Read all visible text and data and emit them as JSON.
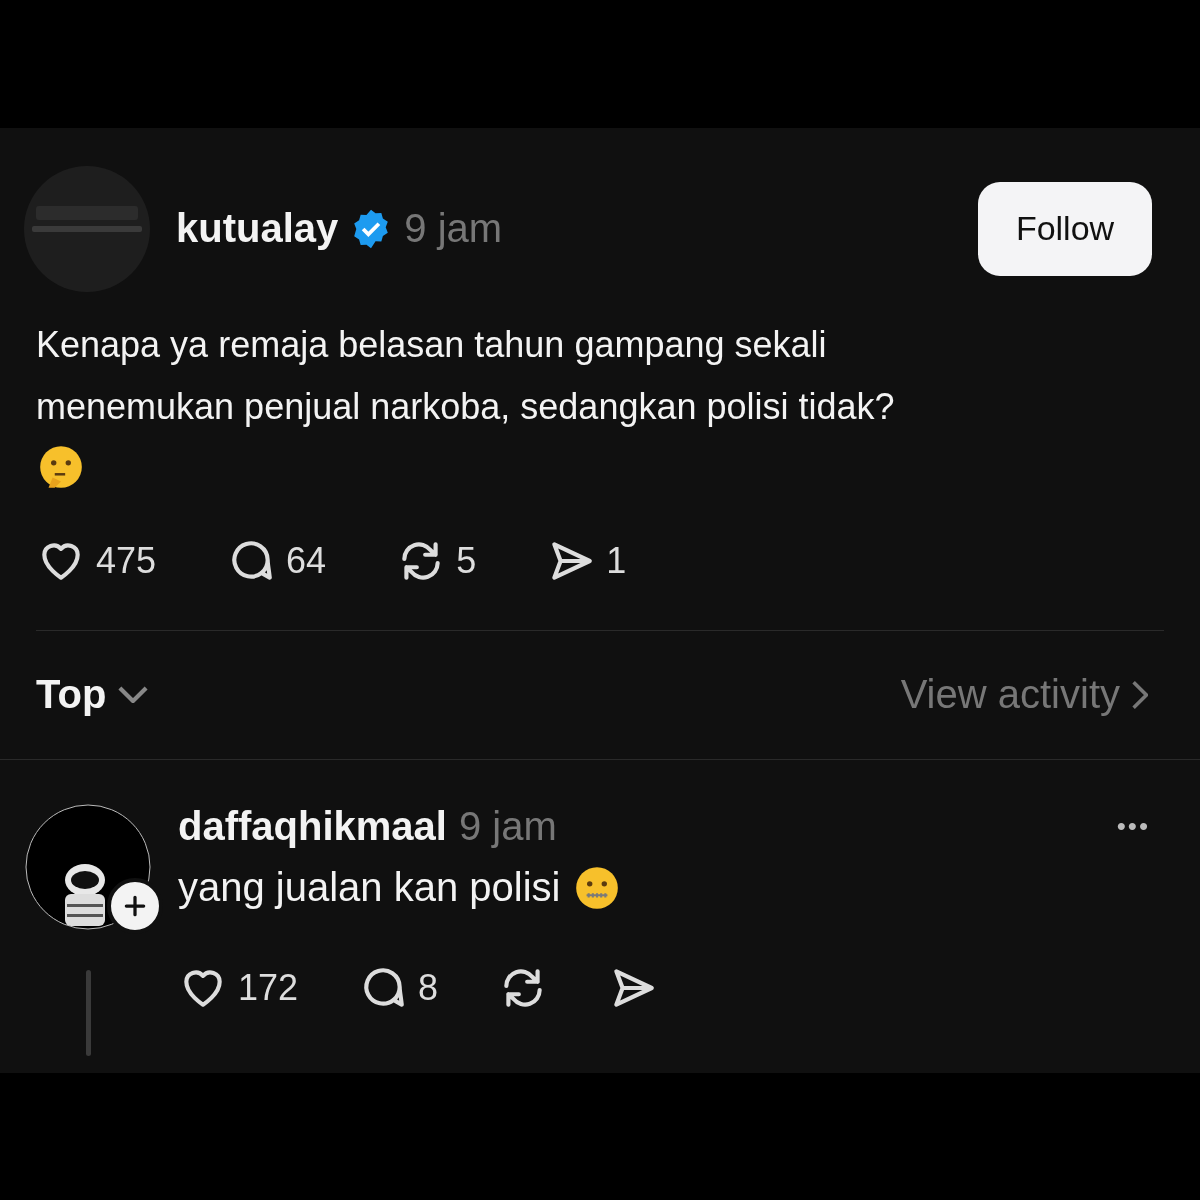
{
  "post": {
    "username": "kutualay",
    "verified": true,
    "time": "9 jam",
    "follow_button": "Follow",
    "text": "Kenapa ya remaja belasan tahun gampang sekali menemukan penjual narkoba, sedangkan polisi tidak?",
    "actions": [
      {
        "kind": "like",
        "count": "475"
      },
      {
        "kind": "reply",
        "count": "64"
      },
      {
        "kind": "repost",
        "count": "5"
      },
      {
        "kind": "share",
        "count": "1"
      }
    ]
  },
  "sort": {
    "label": "Top",
    "link": "View activity"
  },
  "comments": [
    {
      "username": "daffaqhikmaal",
      "time": "9 jam",
      "text": "yang jualan kan polisi",
      "more": "•••",
      "actions": [
        {
          "kind": "like",
          "count": "172"
        },
        {
          "kind": "reply",
          "count": "8"
        },
        {
          "kind": "repost"
        },
        {
          "kind": "share"
        }
      ]
    }
  ]
}
